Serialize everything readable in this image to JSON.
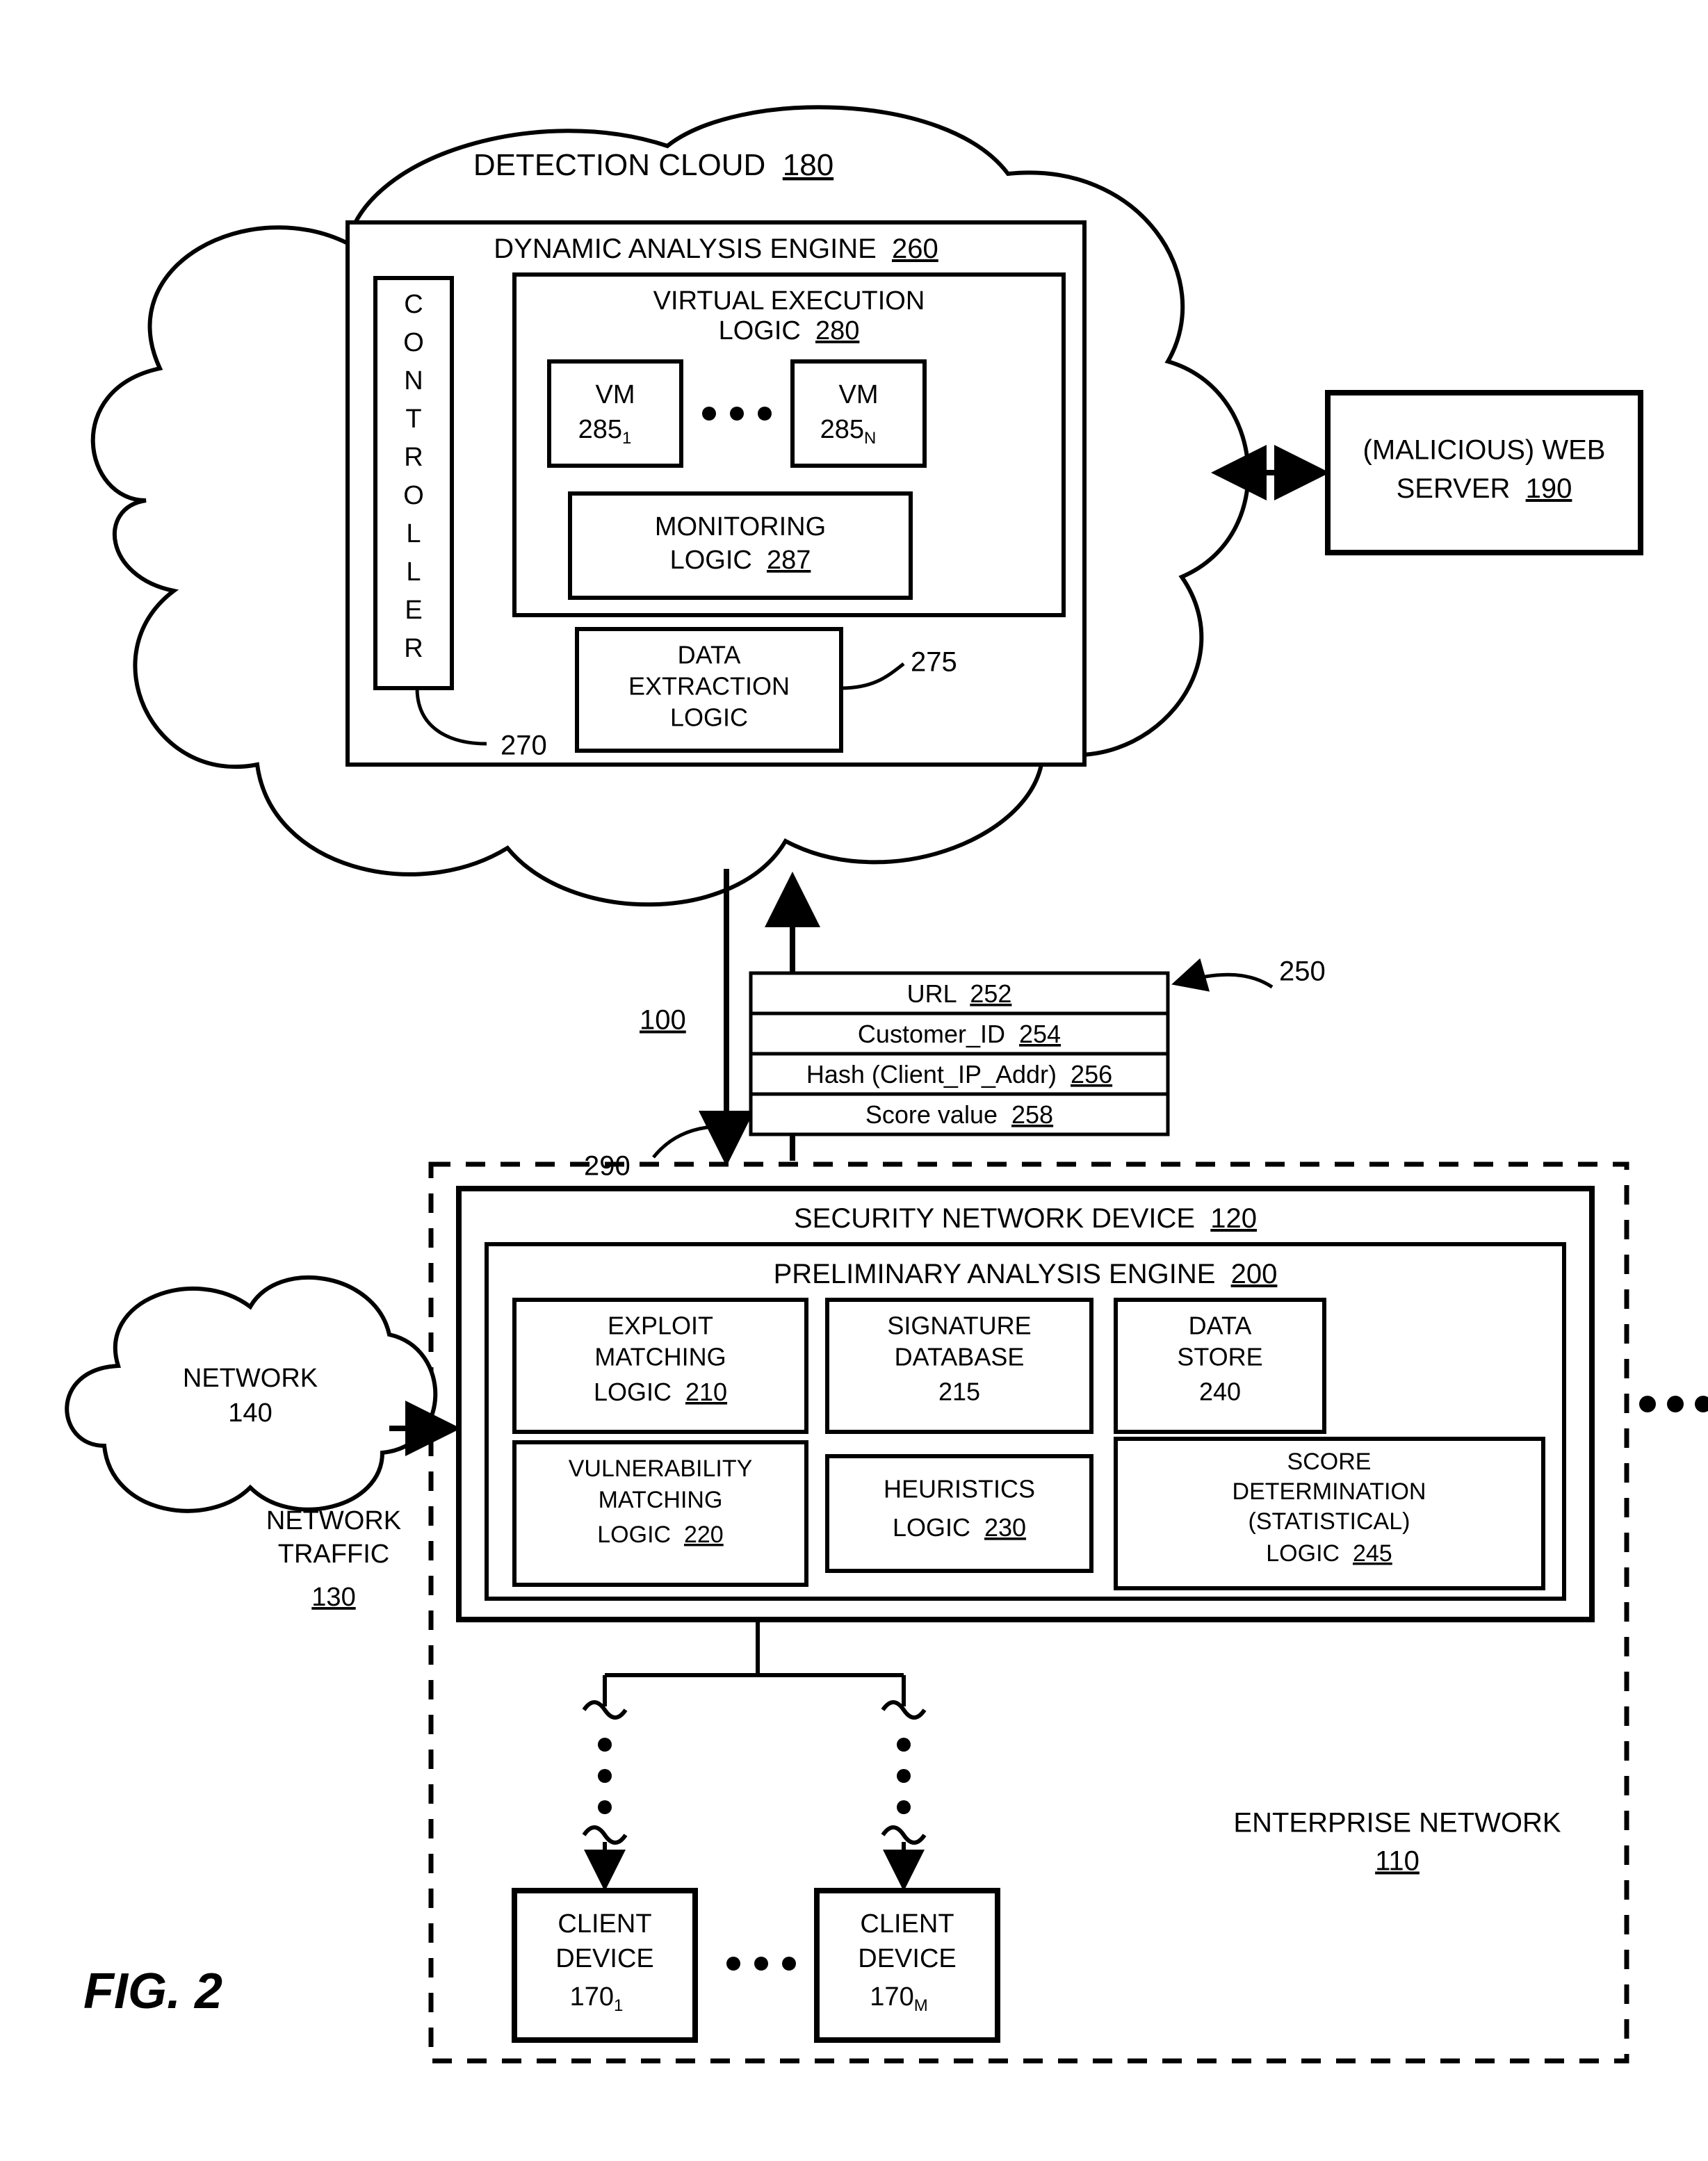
{
  "figure_label": "FIG. 2",
  "ref100": "100",
  "cloud": {
    "title": "DETECTION CLOUD",
    "ref": "180",
    "dae": {
      "title": "DYNAMIC ANALYSIS ENGINE",
      "ref": "260"
    },
    "controller": "CONTROLLER",
    "controller_ref": "270",
    "vel": {
      "l1": "VIRTUAL EXECUTION",
      "l2": "LOGIC",
      "ref": "280"
    },
    "vm1": {
      "l1": "VM",
      "l2": "285",
      "sub": "1"
    },
    "vmn": {
      "l1": "VM",
      "l2": "285",
      "sub": "N"
    },
    "mon": {
      "l1": "MONITORING",
      "l2": "LOGIC",
      "ref": "287"
    },
    "del": {
      "l1": "DATA",
      "l2": "EXTRACTION",
      "l3": "LOGIC"
    },
    "del_ref": "275"
  },
  "webserver": {
    "l1": "(MALICIOUS) WEB",
    "l2": "SERVER",
    "ref": "190"
  },
  "msg": {
    "url": {
      "t": "URL",
      "r": "252"
    },
    "cust": {
      "t": "Customer_ID",
      "r": "254"
    },
    "hash": {
      "t": "Hash (Client_IP_Addr)",
      "r": "256"
    },
    "score": {
      "t": "Score value",
      "r": "258"
    },
    "ref": "250",
    "down_ref": "290"
  },
  "snd": {
    "title": "SECURITY NETWORK DEVICE",
    "ref": "120"
  },
  "pae": {
    "title": "PRELIMINARY ANALYSIS ENGINE",
    "ref": "200"
  },
  "eml": {
    "l1": "EXPLOIT",
    "l2": "MATCHING",
    "l3": "LOGIC",
    "ref": "210"
  },
  "sigdb": {
    "l1": "SIGNATURE",
    "l2": "DATABASE",
    "ref": "215"
  },
  "ds": {
    "l1": "DATA",
    "l2": "STORE",
    "ref": "240"
  },
  "vml": {
    "l1": "VULNERABILITY",
    "l2": "MATCHING",
    "l3": "LOGIC",
    "ref": "220"
  },
  "heur": {
    "l1": "HEURISTICS",
    "l2": "LOGIC",
    "ref": "230"
  },
  "sdl": {
    "l1": "SCORE",
    "l2": "DETERMINATION",
    "l3": "(STATISTICAL)",
    "l4": "LOGIC",
    "ref": "245"
  },
  "network": {
    "t": "NETWORK",
    "r": "140"
  },
  "traffic": {
    "l1": "NETWORK",
    "l2": "TRAFFIC",
    "ref": "130"
  },
  "enterprise": {
    "l1": "ENTERPRISE NETWORK",
    "ref": "110"
  },
  "client1": {
    "l1": "CLIENT",
    "l2": "DEVICE",
    "ref": "170",
    "sub": "1"
  },
  "clientm": {
    "l1": "CLIENT",
    "l2": "DEVICE",
    "ref": "170",
    "sub": "M"
  }
}
